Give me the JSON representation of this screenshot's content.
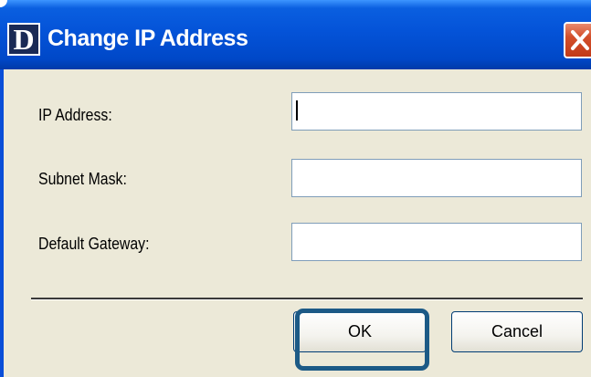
{
  "window": {
    "logo_letter": "D",
    "title": "Change IP Address",
    "close_glyph": "✕"
  },
  "form": {
    "ip_label": "IP Address:",
    "subnet_label": "Subnet Mask:",
    "gateway_label": "Default Gateway:",
    "ip_value": "",
    "subnet_value": "",
    "gateway_value": ""
  },
  "buttons": {
    "ok_label": "OK",
    "cancel_label": "Cancel"
  },
  "colors": {
    "title_bar": "#0453d8",
    "dialog_bg": "#ece9d8",
    "close_button": "#d34f2b",
    "highlight": "#1c5a86"
  },
  "icons": {
    "logo": "d-logo-icon",
    "close": "close-icon"
  }
}
